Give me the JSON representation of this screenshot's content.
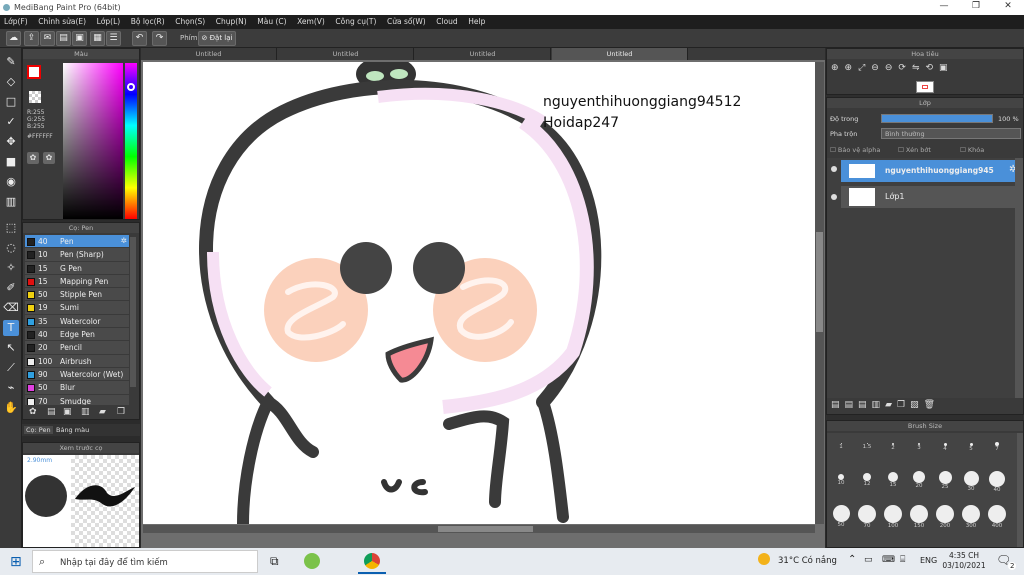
{
  "window": {
    "title": "MediBang Paint Pro (64bit)"
  },
  "menu": [
    "Lớp(F)",
    "Chỉnh sửa(E)",
    "Lớp(L)",
    "Bộ lọc(R)",
    "Chọn(S)",
    "Chụp(N)",
    "Màu (C)",
    "Xem(V)",
    "Công cụ(T)",
    "Cửa sổ(W)",
    "Cloud",
    "Help"
  ],
  "toolbar": {
    "brush_label": "Phím",
    "reset_label": "Đặt lại"
  },
  "color_panel": {
    "title": "Màu",
    "r": "R:255",
    "g": "G:255",
    "b": "B:255",
    "hex": "#FFFFFF"
  },
  "brush_panel": {
    "title": "Cọ: Pen",
    "items": [
      {
        "size": "40",
        "name": "Pen",
        "color": "#222222"
      },
      {
        "size": "10",
        "name": "Pen (Sharp)",
        "color": "#222222"
      },
      {
        "size": "15",
        "name": "G Pen",
        "color": "#222222"
      },
      {
        "size": "15",
        "name": "Mapping Pen",
        "color": "#e01010"
      },
      {
        "size": "50",
        "name": "Stipple Pen",
        "color": "#f0d010"
      },
      {
        "size": "19",
        "name": "Sumi",
        "color": "#f0d010"
      },
      {
        "size": "35",
        "name": "Watercolor",
        "color": "#30a0e0"
      },
      {
        "size": "40",
        "name": "Edge Pen",
        "color": "#222222"
      },
      {
        "size": "20",
        "name": "Pencil",
        "color": "#222222"
      },
      {
        "size": "100",
        "name": "Airbrush",
        "color": "#eeeeee"
      },
      {
        "size": "90",
        "name": "Watercolor (Wet)",
        "color": "#30a0e0"
      },
      {
        "size": "50",
        "name": "Blur",
        "color": "#e040e0"
      },
      {
        "size": "70",
        "name": "Smudge",
        "color": "#eeeeee"
      }
    ],
    "tabs": [
      "Cọ: Pen",
      "Bảng màu"
    ]
  },
  "preview": {
    "title": "Xem trước cọ",
    "size": "2.90mm"
  },
  "doc_tabs": [
    "Untitled",
    "Untitled",
    "Untitled",
    "Untitled"
  ],
  "canvas": {
    "watermark_line1": "nguyenthihuonggiang94512",
    "watermark_line2": "Hoidap247"
  },
  "navigator": {
    "title": "Hoa tiêu"
  },
  "layers": {
    "title": "Lớp",
    "opacity_label": "Độ trong",
    "opacity_value": "100 %",
    "opacity": 1.0,
    "blend_label": "Pha trộn",
    "blend_value": "Bình thường",
    "protect_alpha": "Bảo vệ alpha",
    "clipping": "Xén bớt",
    "lock": "Khóa",
    "items": [
      {
        "name": "nguyenthihuonggiang945",
        "selected": true
      },
      {
        "name": "Lớp1",
        "selected": false
      }
    ]
  },
  "brush_size": {
    "title": "Brush Size",
    "labels": [
      "1",
      "1.5",
      "2",
      "3",
      "4",
      "5",
      "7",
      "10",
      "12",
      "15",
      "20",
      "25",
      "30",
      "40",
      "50",
      "70",
      "100",
      "150",
      "200",
      "300",
      "400"
    ]
  },
  "taskbar": {
    "search_placeholder": "Nhập tại đây để tìm kiếm",
    "weather": "31°C Có nắng",
    "lang": "ENG",
    "time": "4:35 CH",
    "date": "03/10/2021",
    "notifications": "2"
  }
}
